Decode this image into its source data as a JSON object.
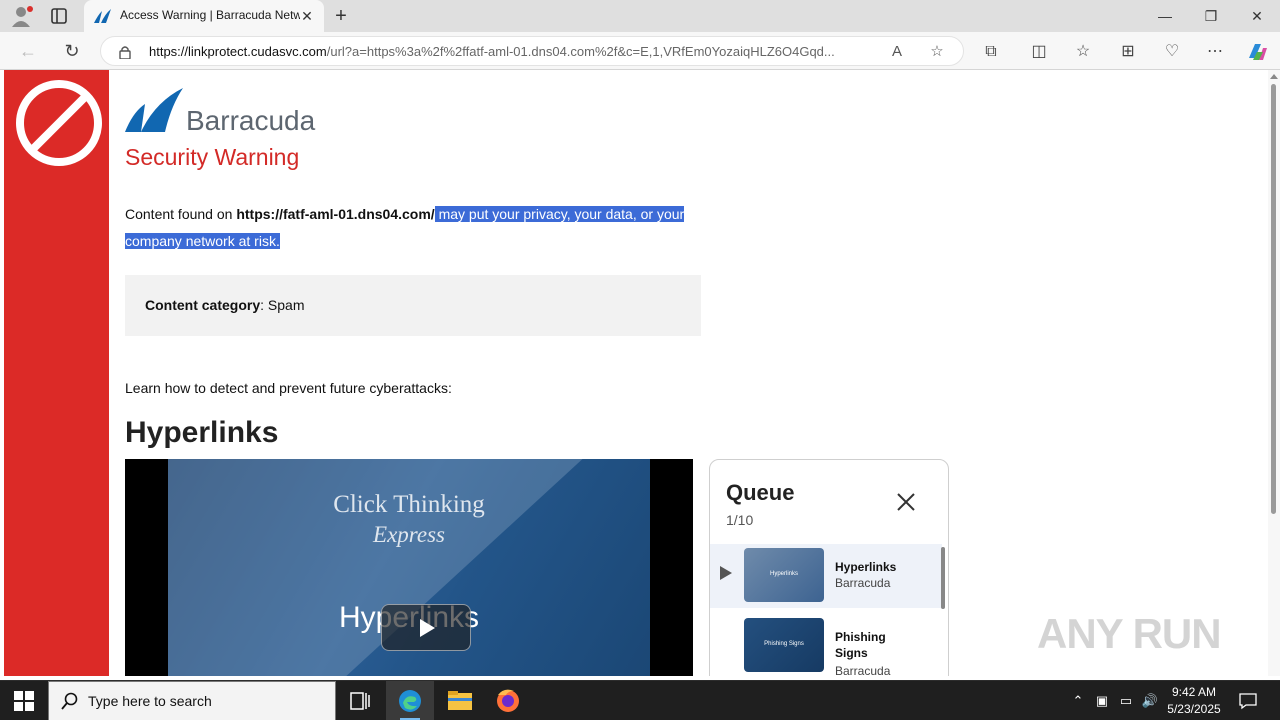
{
  "browser": {
    "tab_title": "Access Warning | Barracuda Netw",
    "new_tab": "+",
    "url_domain": "https://linkprotect.cudasvc.com",
    "url_rest": "/url?a=https%3a%2f%2ffatf-aml-01.dns04.com%2f&c=E,1,VRfEm0YozaiqHLZ6O4Gqd...",
    "minimize": "—",
    "maximize": "❐",
    "close": "✕"
  },
  "page": {
    "brand": "Barracuda",
    "warning_title": "Security Warning",
    "msg_prefix": "Content found on ",
    "msg_url": "https://fatf-aml-01.dns04.com/",
    "msg_suffix": " may put your privacy, your data, or your company network at risk.",
    "category_label": "Content category",
    "category_value": ": Spam",
    "learn_text": "Learn how to detect and prevent future cyberattacks:",
    "section_title": "Hyperlinks"
  },
  "video": {
    "line1": "Click Thinking",
    "line2": "Express",
    "line3": "Hyperlinks"
  },
  "queue": {
    "title": "Queue",
    "count": "1/10",
    "items": [
      {
        "name": "Hyperlinks",
        "author": "Barracuda",
        "thumb_text": "Hyperlinks"
      },
      {
        "name": "Phishing Signs",
        "author": "Barracuda",
        "thumb_text": "Phishing Signs"
      }
    ]
  },
  "watermark": "ANY RUN",
  "taskbar": {
    "search_placeholder": "Type here to search",
    "time": "9:42 AM",
    "date": "5/23/2025"
  },
  "colors": {
    "warning_red": "#dc2a27",
    "selection": "#3c6bd7"
  }
}
